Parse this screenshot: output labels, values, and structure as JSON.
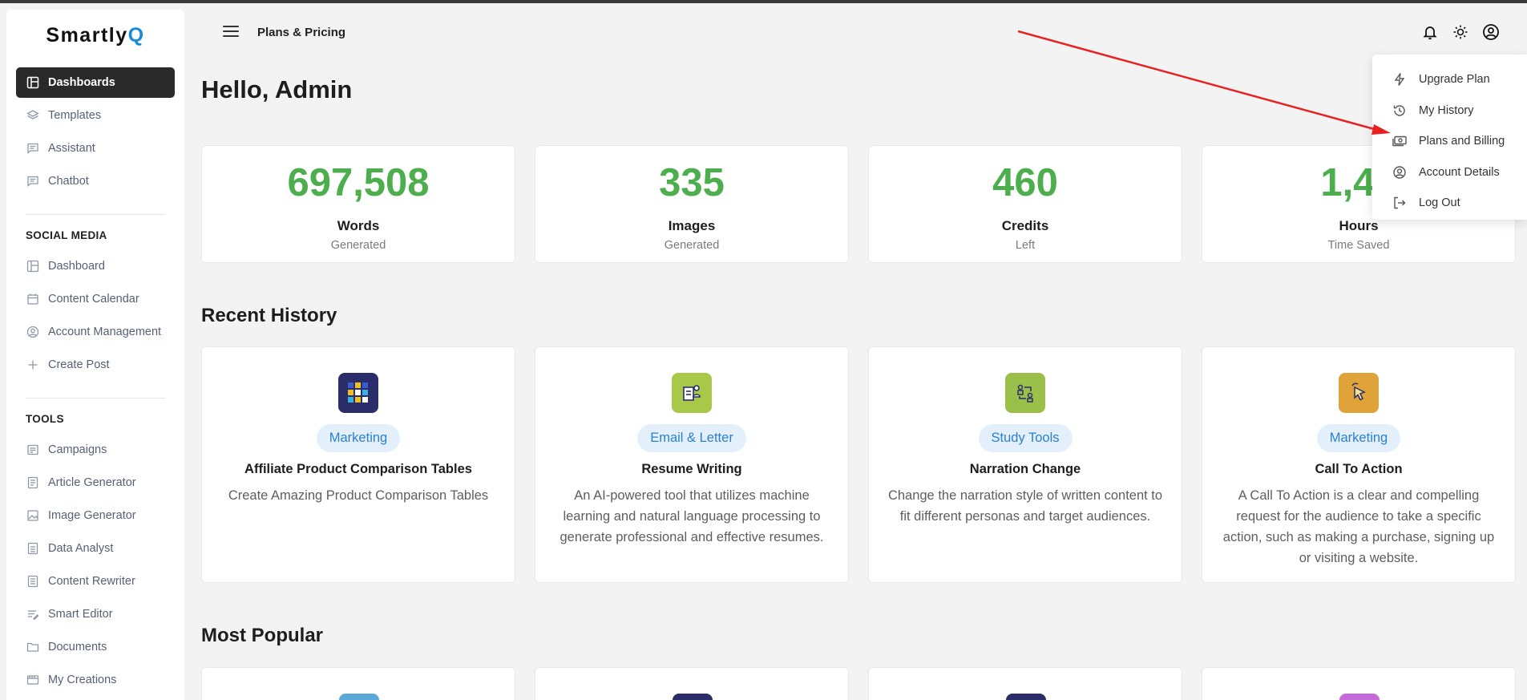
{
  "brand": {
    "prefix": "Smartly",
    "suffix": "Q"
  },
  "header": {
    "title": "Plans & Pricing"
  },
  "greeting": "Hello, Admin",
  "sidebar": {
    "main_items": [
      {
        "label": "Dashboards",
        "icon": "layout-icon",
        "active": true
      },
      {
        "label": "Templates",
        "icon": "layers-icon"
      },
      {
        "label": "Assistant",
        "icon": "message-icon"
      },
      {
        "label": "Chatbot",
        "icon": "message-icon"
      }
    ],
    "social_title": "SOCIAL MEDIA",
    "social_items": [
      {
        "label": "Dashboard",
        "icon": "layout-icon"
      },
      {
        "label": "Content Calendar",
        "icon": "calendar-icon"
      },
      {
        "label": "Account Management",
        "icon": "user-circle-icon"
      },
      {
        "label": "Create Post",
        "icon": "plus-icon"
      }
    ],
    "tools_title": "TOOLS",
    "tools_items": [
      {
        "label": "Campaigns",
        "icon": "campaign-icon"
      },
      {
        "label": "Article Generator",
        "icon": "article-icon"
      },
      {
        "label": "Image Generator",
        "icon": "image-icon"
      },
      {
        "label": "Data Analyst",
        "icon": "data-icon"
      },
      {
        "label": "Content Rewriter",
        "icon": "rewrite-icon"
      },
      {
        "label": "Smart Editor",
        "icon": "editor-icon"
      },
      {
        "label": "Documents",
        "icon": "folder-icon"
      },
      {
        "label": "My Creations",
        "icon": "creations-icon"
      }
    ]
  },
  "stats": [
    {
      "value": "697,508",
      "label": "Words",
      "sub": "Generated"
    },
    {
      "value": "335",
      "label": "Images",
      "sub": "Generated"
    },
    {
      "value": "460",
      "label": "Credits",
      "sub": "Left"
    },
    {
      "value": "1,40",
      "label": "Hours",
      "sub": "Time Saved"
    }
  ],
  "recent_history_title": "Recent History",
  "recent_history": [
    {
      "tag": "Marketing",
      "title": "Affiliate Product Comparison Tables",
      "desc": "Create Amazing Product Comparison Tables",
      "icon_color": "#2b2d6b",
      "icon": "grid-icon"
    },
    {
      "tag": "Email & Letter",
      "title": "Resume Writing",
      "desc": "An AI-powered tool that utilizes machine learning and natural language processing to generate professional and effective resumes.",
      "icon_color": "#a8c84a",
      "icon": "resume-icon"
    },
    {
      "tag": "Study Tools",
      "title": "Narration Change",
      "desc": "Change the narration style of written content to fit different personas and target audiences.",
      "icon_color": "#9bc04a",
      "icon": "narration-icon"
    },
    {
      "tag": "Marketing",
      "title": "Call To Action",
      "desc": "A Call To Action is a clear and compelling request for the audience to take a specific action, such as making a purchase, signing up or visiting a website.",
      "icon_color": "#e0a33a",
      "icon": "cursor-icon"
    }
  ],
  "most_popular_title": "Most Popular",
  "most_popular_icon_colors": [
    "#5aa8d8",
    "#2b2d6b",
    "#2b2d6b",
    "#c56ad8"
  ],
  "dropdown": [
    {
      "label": "Upgrade Plan",
      "icon": "bolt-icon"
    },
    {
      "label": "My History",
      "icon": "history-icon"
    },
    {
      "label": "Plans and Billing",
      "icon": "billing-icon"
    },
    {
      "label": "Account Details",
      "icon": "user-circle-icon"
    },
    {
      "label": "Log Out",
      "icon": "logout-icon"
    }
  ],
  "colors": {
    "accent_green": "#4cae4c",
    "tag_blue": "#2a7fd0",
    "annotation_red": "#e82020"
  }
}
